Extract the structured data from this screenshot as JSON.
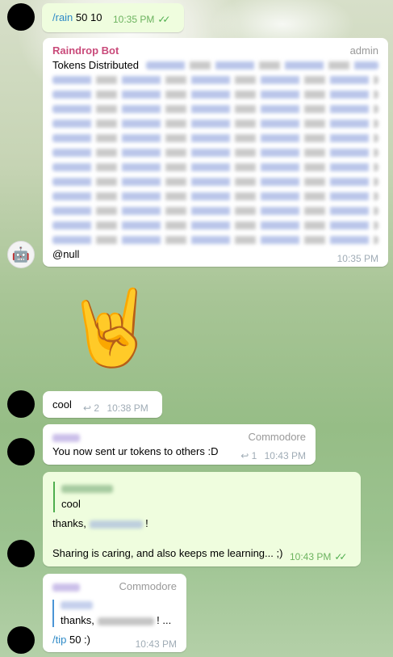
{
  "messages": {
    "m1": {
      "text": "/rain",
      "value": "50 10",
      "time": "10:35 PM"
    },
    "m2": {
      "sender": "Raindrop Bot",
      "role": "admin",
      "text": "Tokens Distributed",
      "mention": "@null",
      "time": "10:35 PM"
    },
    "m3": {
      "emoji": "🤘"
    },
    "m4": {
      "text": "cool",
      "reply_count": "2",
      "time": "10:38 PM"
    },
    "m5": {
      "role": "Commodore",
      "text": "You now sent ur tokens to others :D",
      "reply_count": "1",
      "time": "10:43 PM"
    },
    "m6": {
      "quote_text": "cool",
      "thanks": "thanks,",
      "exclaim": "!",
      "text": "Sharing is caring, and also keeps me learning... ;)",
      "time": "10:43 PM"
    },
    "m7": {
      "role": "Commodore",
      "quote_text": "thanks,",
      "quote_suffix": "! ...",
      "cmd": "/tip",
      "value": "50 :)",
      "time": "10:43 PM"
    }
  },
  "icons": {
    "reply": "reply-icon",
    "double_check": "double-check-icon",
    "bot_avatar": "robot-icon"
  },
  "colors": {
    "link": "#2e8ac7",
    "bot_name": "#c94a7a",
    "outgoing": "#effdde",
    "check": "#4fae4e"
  }
}
